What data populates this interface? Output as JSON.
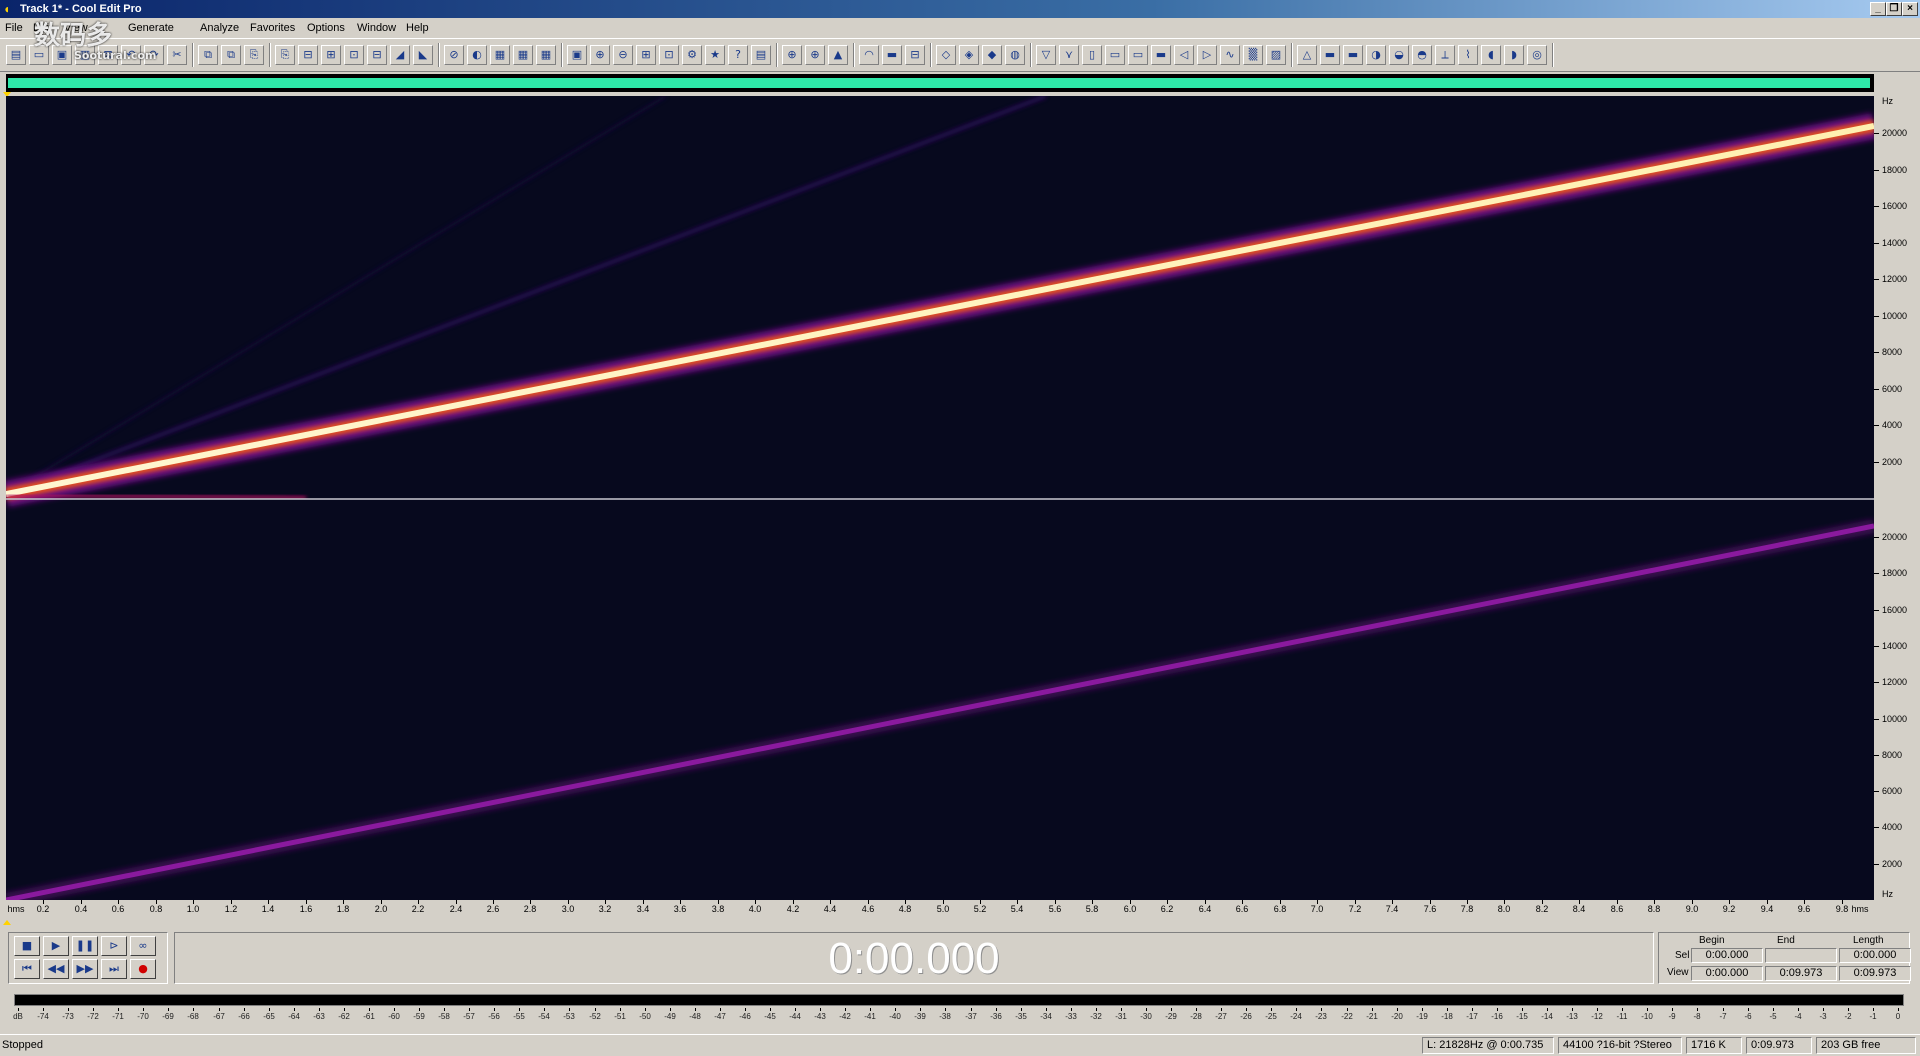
{
  "window": {
    "title": "Track 1* - Cool Edit Pro"
  },
  "menu": [
    "File",
    "Edit",
    "View",
    "Generate",
    "Analyze",
    "Favorites",
    "Options",
    "Window",
    "Help"
  ],
  "watermark": {
    "line1": "数码多",
    "line2": "Sootural.com"
  },
  "toolbar": {
    "icons": [
      "multitrack-icon",
      "open-icon",
      "save-icon",
      "save-all-icon",
      "close-file-icon",
      "undo-icon",
      "redo-icon",
      "repeat-last-icon",
      "copy-new-icon",
      "cut-icon",
      "copy-icon",
      "paste-icon",
      "paste-new-icon",
      "mix-paste-icon",
      "trim-icon",
      "delete-silence-icon",
      "waveform-view-icon",
      "spectral-view-icon",
      "stereo-phase-icon",
      "spectral-pan-icon",
      "show-frequency-icon",
      "show-cue-list-icon",
      "show-playlist-icon",
      "show-time-icon",
      "zoom-in-icon",
      "zoom-out-icon",
      "zoom-full-icon",
      "zoom-selection-icon",
      "settings-icon",
      "favorites-icon",
      "help-icon",
      "wave-properties-icon",
      "zoom-vertical-icon",
      "zoom-horizontal-icon",
      "amplify-icon",
      "envelope-icon",
      "normalize-icon",
      "channel-mixer-icon",
      "delay-icon",
      "echo-icon",
      "flanger-icon",
      "reverb-icon",
      "filter-icon",
      "dynamics-icon",
      "noise-reduction-icon",
      "pitch-icon",
      "stretch-icon",
      "time-warp-icon",
      "invert-icon",
      "reverse-icon",
      "brainwave-icon",
      "dtmf-icon",
      "noise-icon",
      "tones-icon",
      "silence-icon",
      "chorus-icon",
      "distortion-icon",
      "doppler-icon",
      "envelope-follow-icon",
      "sweep-icon",
      "delay-effect-icon",
      "multitap-icon",
      "quick-verb-icon",
      "vocal-remover-icon"
    ]
  },
  "spectrogram": {
    "freq_unit": "Hz",
    "freq_labels": [
      "20000",
      "18000",
      "16000",
      "14000",
      "12000",
      "10000",
      "8000",
      "6000",
      "4000",
      "2000"
    ],
    "time_start_label": "hms",
    "time_end_label": "hms",
    "time_labels": [
      "0.2",
      "0.4",
      "0.6",
      "0.8",
      "1.0",
      "1.2",
      "1.4",
      "1.6",
      "1.8",
      "2.0",
      "2.2",
      "2.4",
      "2.6",
      "2.8",
      "3.0",
      "3.2",
      "3.4",
      "3.6",
      "3.8",
      "4.0",
      "4.2",
      "4.4",
      "4.6",
      "4.8",
      "5.0",
      "5.2",
      "5.4",
      "5.6",
      "5.8",
      "6.0",
      "6.2",
      "6.4",
      "6.6",
      "6.8",
      "7.0",
      "7.2",
      "7.4",
      "7.6",
      "7.8",
      "8.0",
      "8.2",
      "8.4",
      "8.6",
      "8.8",
      "9.0",
      "9.2",
      "9.4",
      "9.6",
      "9.8"
    ]
  },
  "transport": {
    "buttons": [
      "stop-icon",
      "play-icon",
      "pause-icon",
      "play-to-end-icon",
      "loop-icon",
      "go-to-start-icon",
      "rewind-icon",
      "fast-forward-icon",
      "go-to-end-icon",
      "record-icon"
    ],
    "time": "0:00.000"
  },
  "selection": {
    "headers": {
      "begin": "Begin",
      "end": "End",
      "length": "Length"
    },
    "sel": {
      "label": "Sel",
      "begin": "0:00.000",
      "end": "",
      "length": "0:00.000"
    },
    "view": {
      "label": "View",
      "begin": "0:00.000",
      "end": "0:09.973",
      "length": "0:09.973"
    }
  },
  "level_meter": {
    "labels": [
      "dB",
      "-74",
      "-73",
      "-72",
      "-71",
      "-70",
      "-69",
      "-68",
      "-67",
      "-66",
      "-65",
      "-64",
      "-63",
      "-62",
      "-61",
      "-60",
      "-59",
      "-58",
      "-57",
      "-56",
      "-55",
      "-54",
      "-53",
      "-52",
      "-51",
      "-50",
      "-49",
      "-48",
      "-47",
      "-46",
      "-45",
      "-44",
      "-43",
      "-42",
      "-41",
      "-40",
      "-39",
      "-38",
      "-37",
      "-36",
      "-35",
      "-34",
      "-33",
      "-32",
      "-31",
      "-30",
      "-29",
      "-28",
      "-27",
      "-26",
      "-25",
      "-24",
      "-23",
      "-22",
      "-21",
      "-20",
      "-19",
      "-18",
      "-17",
      "-16",
      "-15",
      "-14",
      "-13",
      "-12",
      "-11",
      "-10",
      "-9",
      "-8",
      "-7",
      "-6",
      "-5",
      "-4",
      "-3",
      "-2",
      "-1",
      "0"
    ]
  },
  "status": {
    "state": "Stopped",
    "cursor": "L: 21828Hz @  0:00.735",
    "format": "44100 ?16-bit ?Stereo",
    "size": "1716 K",
    "duration": "0:09.973",
    "free": "203 GB free"
  },
  "colors": {
    "spectro_bg": "#07091e",
    "overview_bar": "#2ee8a8",
    "titlebar": "#0a246a",
    "sweep_hot": "#fff4c0",
    "sweep_right": "#7a1090"
  }
}
